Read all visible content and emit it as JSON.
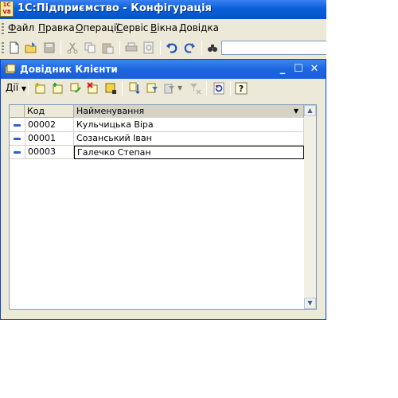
{
  "app": {
    "icon_text_top": "1С",
    "icon_text_bottom": "V8",
    "title": "1С:Підприємство - Конфігурація"
  },
  "menu": {
    "items": [
      {
        "accel": "Ф",
        "rest": "айл"
      },
      {
        "accel": "П",
        "rest": "равка"
      },
      {
        "accel": "О",
        "rest": "перації"
      },
      {
        "accel": "С",
        "rest": "ервіс"
      },
      {
        "accel": "В",
        "rest": "ікна"
      },
      {
        "accel": "Д",
        "rest": "овідка"
      }
    ]
  },
  "toolbar": {
    "icons": [
      "new-document-icon",
      "open-icon",
      "save-icon",
      "cut-icon",
      "copy-icon",
      "paste-icon",
      "print-icon",
      "print-preview-icon",
      "undo-icon",
      "redo-icon",
      "find-icon"
    ],
    "search_value": ""
  },
  "child_window": {
    "title": "Довідник Клієнти",
    "actions_label": "Дії"
  },
  "grid": {
    "columns": [
      "Код",
      "Найменування"
    ],
    "rows": [
      {
        "code": "00002",
        "name": "Кульчицька Віра"
      },
      {
        "code": "00001",
        "name": "Созанський Іван"
      },
      {
        "code": "00003",
        "name": "Галечко Степан"
      }
    ]
  },
  "colors": {
    "title_bar": "#0a5fd8",
    "window_bg": "#ece9d8"
  }
}
